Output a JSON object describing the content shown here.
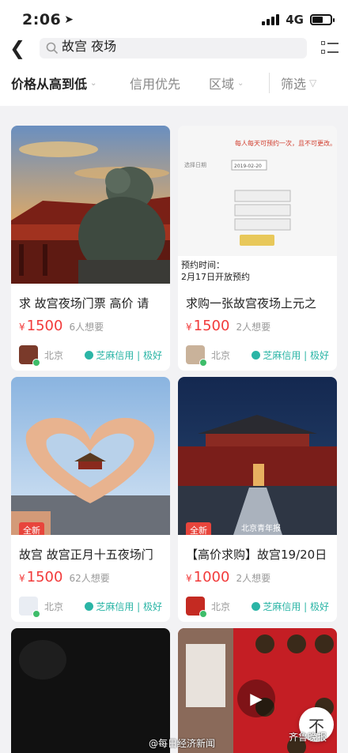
{
  "status": {
    "time": "2:06",
    "network": "4G"
  },
  "search": {
    "query": "故宫 夜场"
  },
  "filters": [
    {
      "label": "价格从高到低",
      "active": true
    },
    {
      "label": "信用优先",
      "active": false
    },
    {
      "label": "区域",
      "active": false
    },
    {
      "label": "筛选",
      "active": false
    }
  ],
  "listings": [
    {
      "title": "求 故宫夜场门票 高价 请",
      "price_symbol": "¥",
      "price": "1500",
      "wants": "6人想要",
      "city": "北京",
      "credit": "芝麻信用 | 极好",
      "badge": ""
    },
    {
      "title": "求购一张故宫夜场上元之",
      "price_symbol": "¥",
      "price": "1500",
      "wants": "2人想要",
      "city": "北京",
      "credit": "芝麻信用 | 极好",
      "badge": ""
    },
    {
      "title": "故宫 故宫正月十五夜场门",
      "price_symbol": "¥",
      "price": "1500",
      "wants": "62人想要",
      "city": "北京",
      "credit": "芝麻信用 | 极好",
      "badge": "全新"
    },
    {
      "title": "【高价求购】故宫19/20日",
      "price_symbol": "¥",
      "price": "1000",
      "wants": "2人想要",
      "city": "北京",
      "credit": "芝麻信用 | 极好",
      "badge": "全新"
    }
  ],
  "ticket_screenshot": {
    "line1": "每人每天可预约一次，且不可更改。",
    "date_label": "选择日期",
    "date_value": "2019-02-20",
    "caption1": "预约时间：",
    "caption2": "2月17日开放预约"
  },
  "photo_watermark": "北京青年报",
  "top_button": "不",
  "watermarks": {
    "weibo": "@每日经济新闻",
    "wechat": "齐鲁晚报"
  },
  "colors": {
    "price": "#f23b3b",
    "credit": "#2bb5a6",
    "badge": "#e8453c"
  }
}
